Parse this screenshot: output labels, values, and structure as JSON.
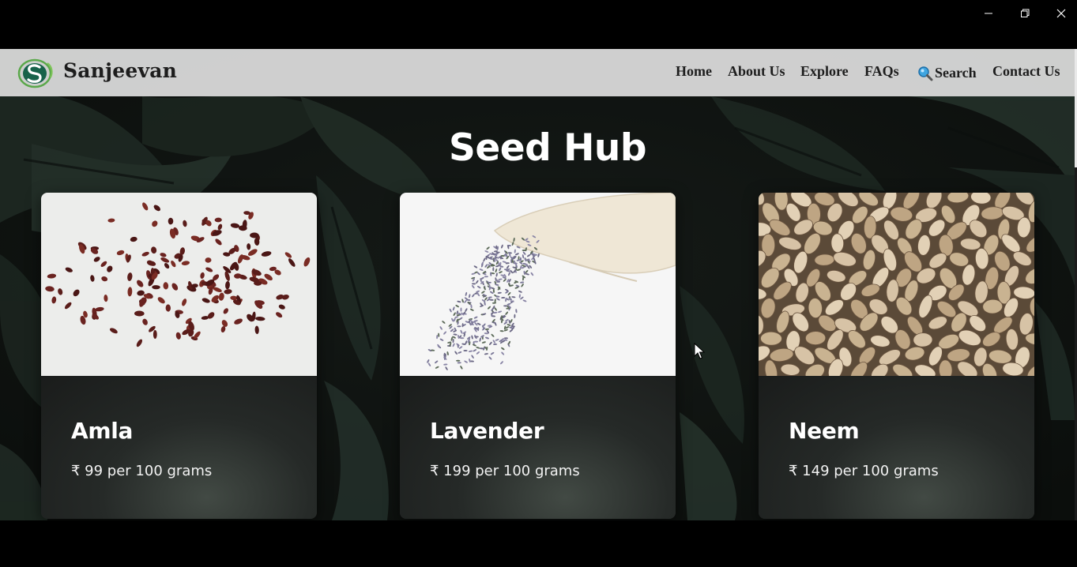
{
  "window": {
    "minimize_icon": "minimize-icon",
    "maximize_icon": "restore-icon",
    "close_icon": "close-icon"
  },
  "navbar": {
    "brand": "Sanjeevan",
    "logo_icon": "sanjeevan-logo-icon",
    "links": {
      "home": "Home",
      "about": "About Us",
      "explore": "Explore",
      "faqs": "FAQs",
      "search": "Search",
      "contact": "Contact Us"
    },
    "search_icon": "magnifier-icon"
  },
  "main": {
    "title": "Seed Hub",
    "products": [
      {
        "name": "Amla",
        "price": "₹ 99 per 100 grams",
        "image": "amla-seeds-image"
      },
      {
        "name": "Lavender",
        "price": "₹ 199 per 100 grams",
        "image": "lavender-seeds-image"
      },
      {
        "name": "Neem",
        "price": "₹ 149 per 100 grams",
        "image": "neem-seeds-image"
      }
    ]
  },
  "colors": {
    "navbar_bg": "#dedede",
    "page_bg": "#0f1311",
    "card_bg": "#1e2220",
    "text_light": "#ffffff",
    "nav_text": "#1d1d1d"
  }
}
